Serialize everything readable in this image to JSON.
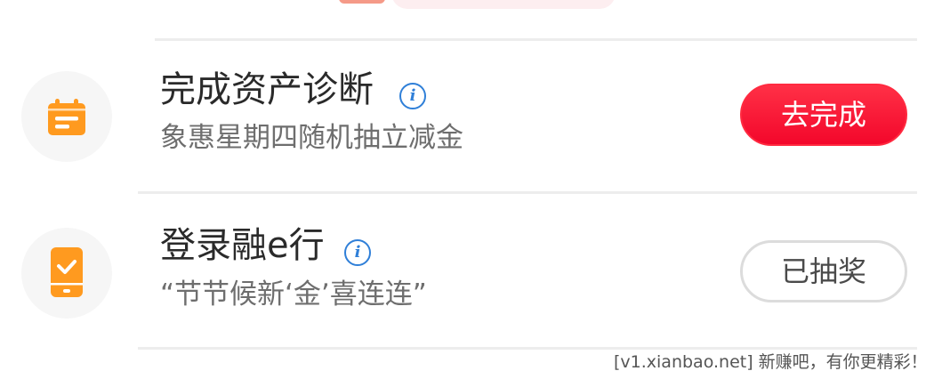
{
  "tasks": [
    {
      "title": "完成资产诊断",
      "subtitle": "象惠星期四随机抽立减金",
      "button_label": "去完成",
      "icon": "calendar-icon",
      "status": "pending"
    },
    {
      "title": "登录融e行",
      "subtitle": "“节节候新‘金’喜连连”",
      "button_label": "已抽奖",
      "icon": "phone-check-icon",
      "status": "done"
    }
  ],
  "watermark": "[v1.xianbao.net] 新赚吧，有你更精彩！",
  "colors": {
    "accent_red": "#f3072b",
    "icon_orange": "#ff9a1f",
    "info_blue": "#2f7fd8"
  }
}
